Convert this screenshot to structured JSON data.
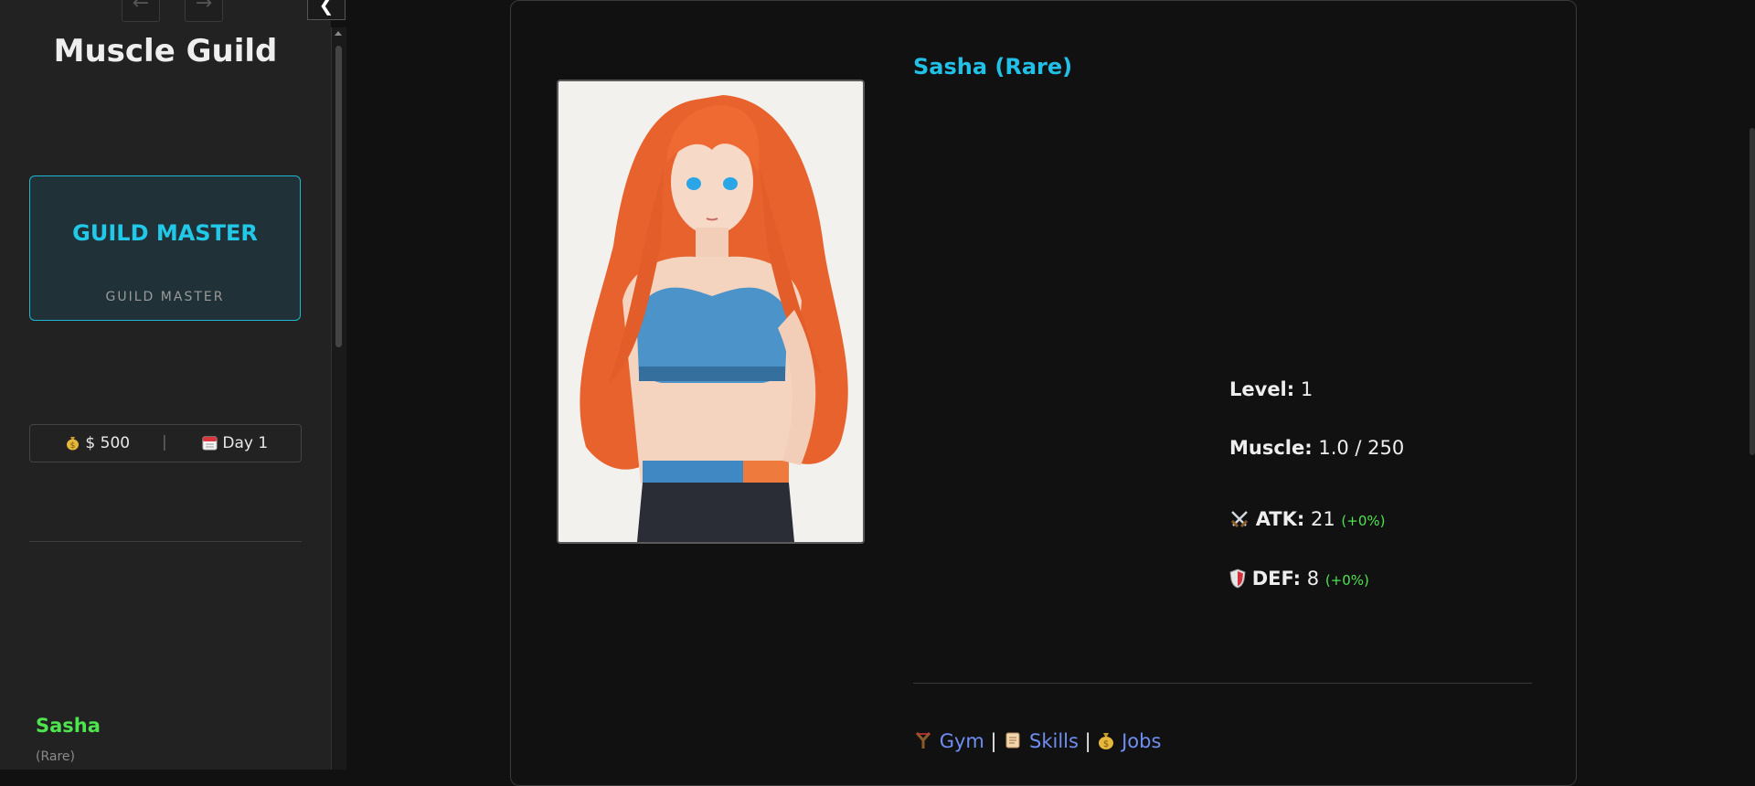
{
  "sidebar": {
    "nav_back_icon": "arrow-left",
    "nav_forward_icon": "arrow-right",
    "title": "Muscle Guild",
    "master_card": {
      "title": "GUILD MASTER",
      "subtitle": "GUILD MASTER"
    },
    "stats": {
      "money": "$ 500",
      "separator": "|",
      "day": "Day 1",
      "money_icon": "money-bag",
      "day_icon": "calendar"
    },
    "character": {
      "name": "Sasha",
      "rarity": "(Rare)"
    },
    "collapse_icon": "chevron-left"
  },
  "detail": {
    "name": "Sasha (Rare)",
    "level": {
      "label": "Level:",
      "value": "1"
    },
    "muscle": {
      "label": "Muscle:",
      "value": "1.0 / 250"
    },
    "atk": {
      "icon": "crossed-swords",
      "label": "ATK:",
      "value": "21",
      "pct": "(+0%)"
    },
    "def": {
      "icon": "shield",
      "label": "DEF:",
      "value": "8",
      "pct": "(+0%)"
    },
    "links": [
      {
        "icon": "slingshot",
        "label": "Gym"
      },
      {
        "icon": "scroll",
        "label": "Skills"
      },
      {
        "icon": "money-bag",
        "label": "Jobs"
      }
    ],
    "link_separator": "|"
  },
  "colors": {
    "accent": "#22c0e6",
    "green": "#4ee44e",
    "link": "#6f8ef2"
  }
}
